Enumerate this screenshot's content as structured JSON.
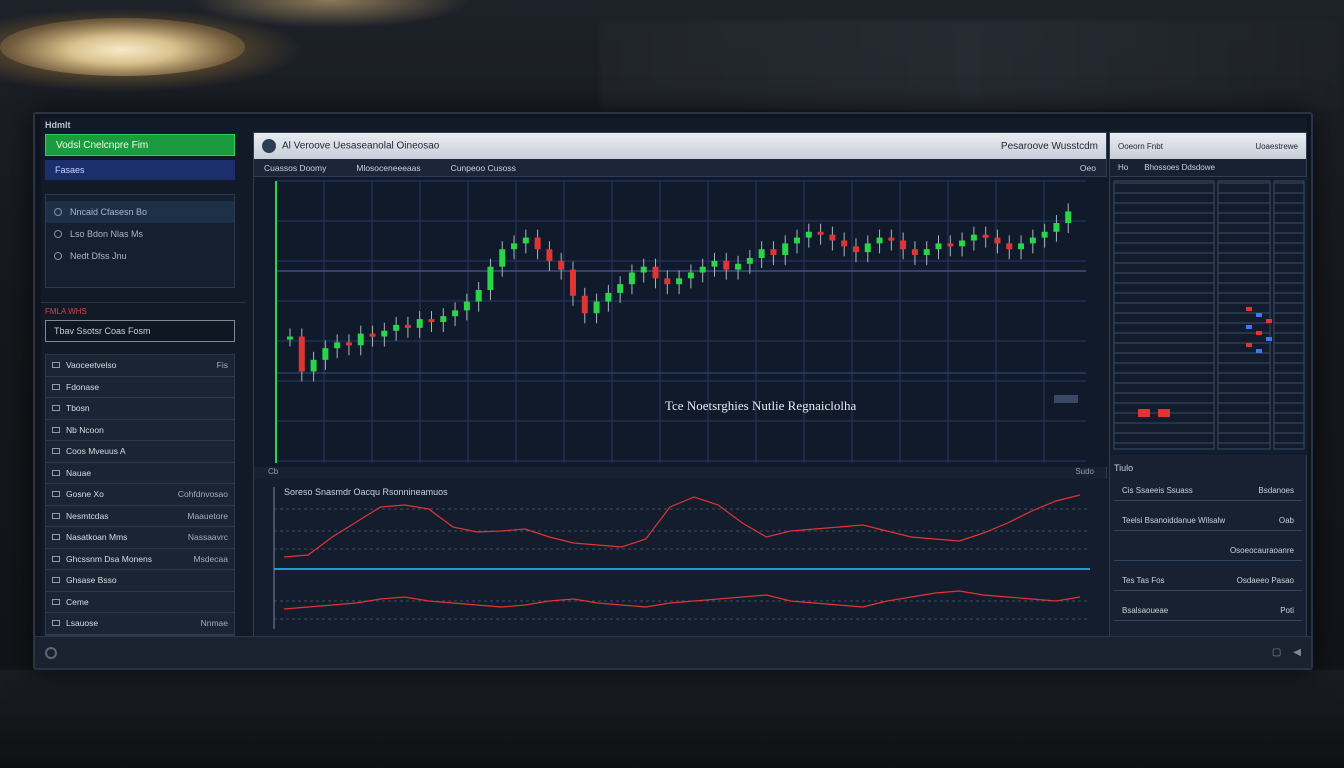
{
  "sidebar": {
    "header": "Hdmlt",
    "primary_button": "Vodsl Cnelcnpre Fim",
    "secondary_button": "Fasaes",
    "group_rows": [
      {
        "label": "Nncaid Cfasesn Bo",
        "selected": true
      },
      {
        "label": "Lso Bdon Nlas Ms",
        "selected": false
      },
      {
        "label": "Nedt Dfss Jnu",
        "selected": false
      }
    ],
    "section_title": "FMLA WHS",
    "filter_label": "Tbav Ssotsr Coas Fosm",
    "list": [
      {
        "left": "Vaoceetvelso",
        "right": "Fis"
      },
      {
        "left": "Fdonase",
        "right": ""
      },
      {
        "left": "Tbosn",
        "right": ""
      },
      {
        "left": "Nb Ncoon",
        "right": ""
      },
      {
        "left": "Coos Mveuus A",
        "right": ""
      },
      {
        "left": "Nauae",
        "right": ""
      },
      {
        "left": "Gosne Xo",
        "right": "Cohfdnvosao"
      },
      {
        "left": "Nesmtcdas",
        "right": "Maauetore"
      },
      {
        "left": "Nasatkoan Mms",
        "right": "Nassaavrc"
      },
      {
        "left": "Ghcssnm Dsa Monens",
        "right": "Msdecaa"
      },
      {
        "left": "Ghsase Bsso",
        "right": ""
      },
      {
        "left": "Ceme",
        "right": ""
      },
      {
        "left": "Lsauose",
        "right": "Nnmae"
      }
    ]
  },
  "main": {
    "title": "Al Veroove Uesaseanolal Oineosao",
    "title_right": "Pesaroove Wusstcdm",
    "toolbar": {
      "left": "Cuassos Doomy",
      "mid": "Mlosoceneeeaas",
      "mid2": "Cunpeoo Cusoss",
      "right": "Oeo"
    },
    "overlay_label": "Tce Noetsrghies Nutlie Regnaiclolha",
    "sub_left": "Cb",
    "sub_right": "Sudo",
    "lower_title": "Soreso Snasmdr Oacqu Rsonnineamuos"
  },
  "right_panel": {
    "title": "Ooeorn Fnbt",
    "title_right": "Uoaestrewe",
    "tool_left": "Ho",
    "tool_right": "Bhossoes Ddsdowe",
    "section": "Tiulo",
    "rows": [
      {
        "left": "Cis Ssaeeis Ssuass",
        "right": "Bsdanoes"
      },
      {
        "left": "Teelsi Bsanoiddanue Wilsalw",
        "right": "Oab"
      },
      {
        "left": "",
        "right": "Osoeocauraoanre"
      },
      {
        "left": "Tes Tas Fos",
        "right": "Osdaeeo Pasao"
      },
      {
        "left": "Bsalsaoueae",
        "right": "Poti"
      }
    ]
  },
  "colors": {
    "up": "#29d64a",
    "down": "#e03535",
    "grid": "#243b66",
    "accent": "#1a9b3d"
  },
  "chart_data": [
    {
      "type": "candlestick",
      "title": "",
      "series": [
        {
          "closes": [
            40,
            28,
            32,
            36,
            38,
            37,
            41,
            40,
            42,
            44,
            43,
            46,
            45,
            47,
            49,
            52,
            56,
            64,
            70,
            72,
            74,
            70,
            66,
            63,
            54,
            48,
            52,
            55,
            58,
            62,
            64,
            60,
            58,
            60,
            62,
            64,
            66,
            63,
            65,
            67,
            70,
            68,
            72,
            74,
            76,
            75,
            73,
            71,
            69,
            72,
            74,
            73,
            70,
            68,
            70,
            72,
            71,
            73,
            75,
            74,
            72,
            70,
            72,
            74,
            76,
            79,
            83
          ]
        }
      ]
    },
    {
      "type": "line",
      "title": "Soreso Snasmdr Oacqu Rsonnineamuos",
      "series": [
        {
          "values": [
            10,
            12,
            30,
            45,
            60,
            62,
            58,
            40,
            35,
            36,
            38,
            30,
            24,
            22,
            20,
            28,
            60,
            70,
            62,
            44,
            30,
            36,
            38,
            40,
            42,
            36,
            30,
            28,
            26,
            34,
            44,
            56,
            66,
            72
          ]
        },
        {
          "values": [
            12,
            14,
            16,
            18,
            22,
            24,
            20,
            18,
            16,
            14,
            16,
            20,
            22,
            18,
            16,
            14,
            18,
            20,
            22,
            24,
            26,
            20,
            18,
            16,
            14,
            20,
            24,
            28,
            30,
            26,
            24,
            22,
            20,
            24
          ]
        }
      ]
    }
  ]
}
